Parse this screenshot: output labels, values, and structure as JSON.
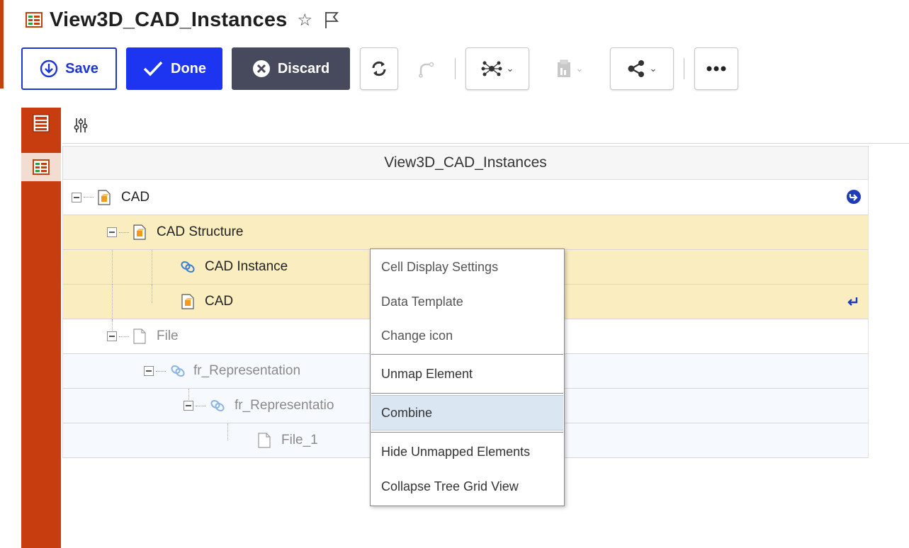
{
  "title": {
    "text": "View3D_CAD_Instances",
    "icon": "grid-view-icon"
  },
  "toolbar": {
    "save_label": "Save",
    "done_label": "Done",
    "discard_label": "Discard",
    "icons": [
      "refresh-icon",
      "redo-icon",
      "network-icon",
      "clipboard-icon",
      "share-icon",
      "more-icon"
    ]
  },
  "grid": {
    "header": "View3D_CAD_Instances",
    "rows": [
      {
        "label": "CAD",
        "icon": "cad-document-icon"
      },
      {
        "label": "CAD Structure",
        "icon": "cad-document-icon"
      },
      {
        "label": "CAD Instance",
        "icon": "relationship-icon"
      },
      {
        "label": "CAD",
        "icon": "cad-document-icon"
      },
      {
        "label": "File",
        "icon": "file-icon"
      },
      {
        "label": "fr_Representation",
        "icon": "relationship-icon"
      },
      {
        "label": "fr_Representatio",
        "icon": "relationship-icon"
      },
      {
        "label": "File_1",
        "icon": "file-icon"
      }
    ]
  },
  "context_menu": {
    "items": [
      "Cell Display Settings",
      "Data Template",
      "Change icon",
      "Unmap Element",
      "Combine",
      "Hide Unmapped Elements",
      "Collapse Tree Grid View"
    ],
    "highlighted": "Combine"
  },
  "colors": {
    "accent_blue": "#1d35f0",
    "sidebar_orange": "#c73d10",
    "row_highlight_yellow": "#faedc0",
    "discard_grey": "#474a5c"
  }
}
